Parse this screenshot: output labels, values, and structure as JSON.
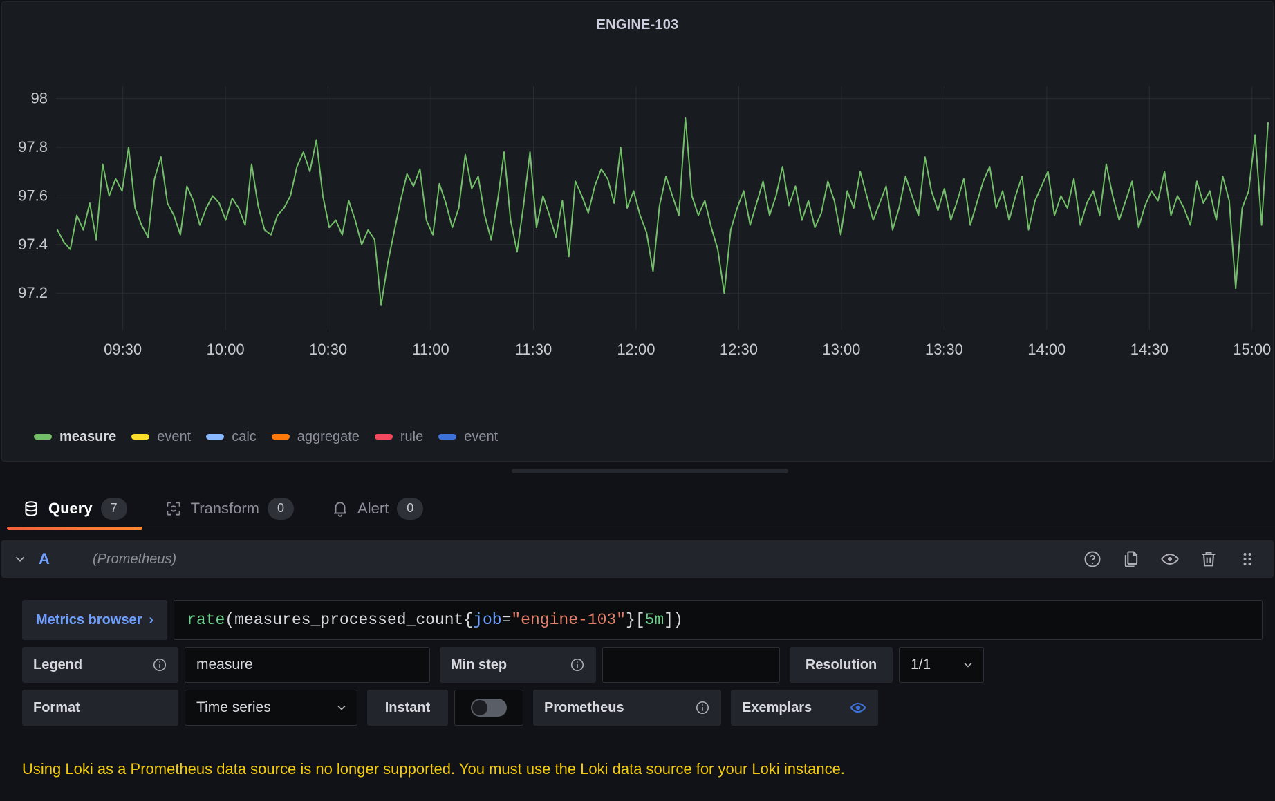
{
  "panel": {
    "title": "ENGINE-103"
  },
  "chart_data": {
    "type": "line",
    "title": "ENGINE-103",
    "xlabel": "",
    "ylabel": "",
    "grid": true,
    "legend_position": "bottom",
    "ylim": [
      97.05,
      98.05
    ],
    "yticks": [
      "97.2",
      "97.4",
      "97.6",
      "97.8",
      "98"
    ],
    "ytick_values": [
      97.2,
      97.4,
      97.6,
      97.8,
      98
    ],
    "xticks": [
      "09:30",
      "10:00",
      "10:30",
      "11:00",
      "11:30",
      "12:00",
      "12:30",
      "13:00",
      "13:30",
      "14:00",
      "14:30",
      "15:00"
    ],
    "series": [
      {
        "name": "measure",
        "color": "#73bf69",
        "values": [
          97.46,
          97.41,
          97.38,
          97.52,
          97.46,
          97.57,
          97.42,
          97.73,
          97.6,
          97.67,
          97.62,
          97.8,
          97.55,
          97.48,
          97.43,
          97.67,
          97.76,
          97.57,
          97.52,
          97.44,
          97.64,
          97.58,
          97.48,
          97.55,
          97.6,
          97.57,
          97.5,
          97.59,
          97.55,
          97.48,
          97.73,
          97.56,
          97.46,
          97.44,
          97.52,
          97.55,
          97.6,
          97.72,
          97.78,
          97.7,
          97.83,
          97.6,
          97.47,
          97.5,
          97.44,
          97.58,
          97.5,
          97.4,
          97.46,
          97.42,
          97.15,
          97.32,
          97.45,
          97.58,
          97.69,
          97.64,
          97.71,
          97.5,
          97.44,
          97.65,
          97.57,
          97.47,
          97.55,
          97.77,
          97.63,
          97.68,
          97.52,
          97.42,
          97.58,
          97.78,
          97.5,
          97.37,
          97.56,
          97.78,
          97.47,
          97.6,
          97.52,
          97.43,
          97.58,
          97.35,
          97.66,
          97.6,
          97.53,
          97.64,
          97.71,
          97.67,
          97.57,
          97.8,
          97.55,
          97.62,
          97.52,
          97.45,
          97.29,
          97.56,
          97.68,
          97.6,
          97.52,
          97.92,
          97.6,
          97.52,
          97.58,
          97.47,
          97.38,
          97.2,
          97.46,
          97.55,
          97.62,
          97.48,
          97.57,
          97.66,
          97.52,
          97.6,
          97.72,
          97.56,
          97.64,
          97.5,
          97.58,
          97.47,
          97.53,
          97.66,
          97.58,
          97.44,
          97.62,
          97.55,
          97.7,
          97.6,
          97.5,
          97.57,
          97.64,
          97.46,
          97.55,
          97.68,
          97.6,
          97.52,
          97.76,
          97.62,
          97.54,
          97.63,
          97.5,
          97.58,
          97.67,
          97.48,
          97.57,
          97.66,
          97.72,
          97.55,
          97.62,
          97.5,
          97.6,
          97.68,
          97.46,
          97.58,
          97.64,
          97.7,
          97.52,
          97.6,
          97.55,
          97.67,
          97.48,
          97.57,
          97.62,
          97.52,
          97.73,
          97.6,
          97.5,
          97.58,
          97.66,
          97.47,
          97.56,
          97.62,
          97.58,
          97.7,
          97.52,
          97.6,
          97.55,
          97.48,
          97.66,
          97.57,
          97.62,
          97.5,
          97.68,
          97.58,
          97.22,
          97.55,
          97.62,
          97.85,
          97.48,
          97.9
        ]
      },
      {
        "name": "event",
        "color": "#fade2a",
        "values": []
      },
      {
        "name": "calc",
        "color": "#8ab8ff",
        "values": []
      },
      {
        "name": "aggregate",
        "color": "#ff780a",
        "values": []
      },
      {
        "name": "rule",
        "color": "#f2495c",
        "values": []
      },
      {
        "name": "event",
        "color": "#3d71d9",
        "values": []
      }
    ],
    "legend": [
      {
        "label": "measure",
        "color": "#73bf69",
        "active": true
      },
      {
        "label": "event",
        "color": "#fade2a",
        "active": false
      },
      {
        "label": "calc",
        "color": "#8ab8ff",
        "active": false
      },
      {
        "label": "aggregate",
        "color": "#ff780a",
        "active": false
      },
      {
        "label": "rule",
        "color": "#f2495c",
        "active": false
      },
      {
        "label": "event",
        "color": "#3d71d9",
        "active": false
      }
    ]
  },
  "tabs": [
    {
      "label": "Query",
      "count": "7",
      "active": true
    },
    {
      "label": "Transform",
      "count": "0",
      "active": false
    },
    {
      "label": "Alert",
      "count": "0",
      "active": false
    }
  ],
  "query_header": {
    "ref_id": "A",
    "datasource": "(Prometheus)"
  },
  "editor": {
    "metrics_browser": "Metrics browser",
    "metrics_browser_chevron": "›",
    "expr_tokens": [
      {
        "text": "rate",
        "type": "fn"
      },
      {
        "text": "(measures_processed_count{",
        "type": "plain"
      },
      {
        "text": "job",
        "type": "key"
      },
      {
        "text": "=",
        "type": "plain"
      },
      {
        "text": "\"engine-103\"",
        "type": "str"
      },
      {
        "text": "}[",
        "type": "plain"
      },
      {
        "text": "5m",
        "type": "dur"
      },
      {
        "text": "])",
        "type": "plain"
      }
    ],
    "legend_label": "Legend",
    "legend_value": "measure",
    "legend_placeholder": "",
    "min_step_label": "Min step",
    "min_step_value": "",
    "resolution_label": "Resolution",
    "resolution_value": "1/1",
    "format_label": "Format",
    "format_value": "Time series",
    "instant_label": "Instant",
    "instant_on": false,
    "prometheus_label": "Prometheus",
    "exemplars_label": "Exemplars"
  },
  "warning": "Using Loki as a Prometheus data source is no longer supported. You must use the Loki data source for your Loki instance."
}
